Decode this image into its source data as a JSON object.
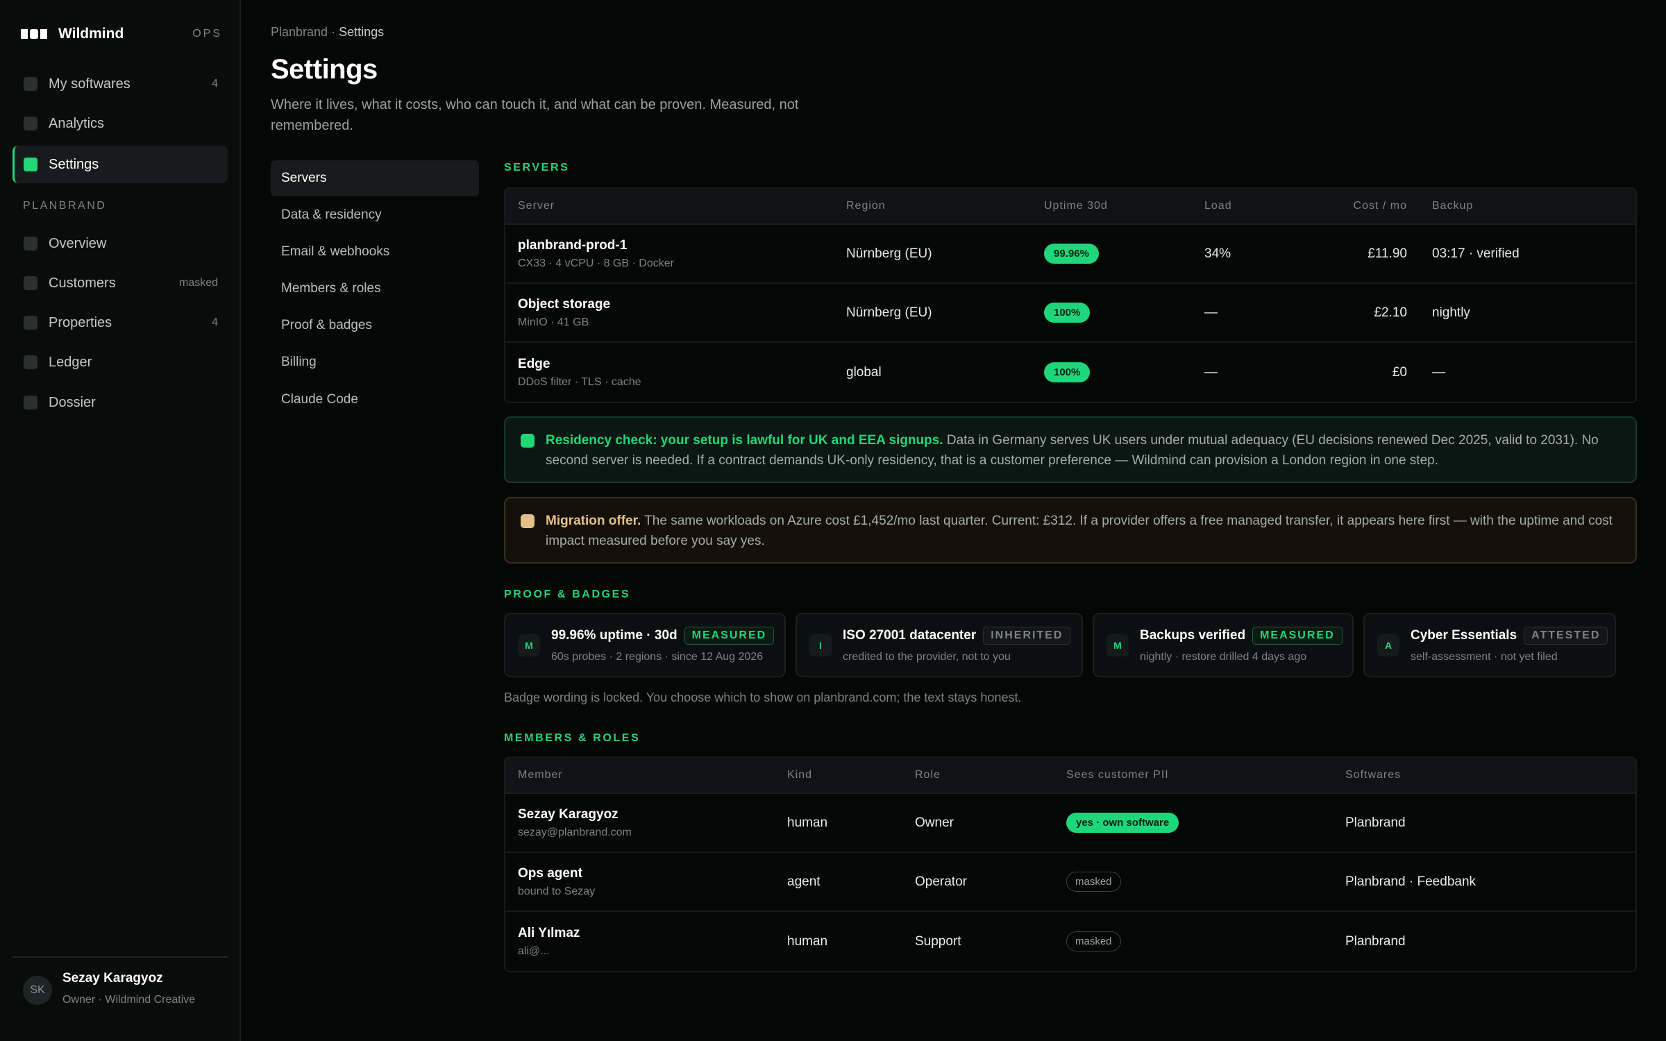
{
  "app": {
    "name": "Wildmind",
    "env": "OPS"
  },
  "sidebar": {
    "items": [
      {
        "label": "My softwares",
        "count": "4"
      },
      {
        "label": "Analytics",
        "count": ""
      },
      {
        "label": "Settings",
        "count": "",
        "active": true
      }
    ],
    "section_label": "PLANBRAND",
    "section_items": [
      {
        "label": "Overview",
        "count": ""
      },
      {
        "label": "Customers",
        "count": "masked"
      },
      {
        "label": "Properties",
        "count": "4"
      },
      {
        "label": "Ledger",
        "count": ""
      },
      {
        "label": "Dossier",
        "count": ""
      }
    ],
    "user": {
      "initials": "SK",
      "name": "Sezay Karagyoz",
      "role": "Owner · Wildmind Creative"
    }
  },
  "header": {
    "breadcrumb_parent": "Planbrand",
    "breadcrumb_sep": "·",
    "breadcrumb_current": "Settings",
    "title": "Settings",
    "subtitle": "Where it lives, what it costs, who can touch it, and what can be proven. Measured, not remembered."
  },
  "subnav": [
    "Servers",
    "Data & residency",
    "Email & webhooks",
    "Members & roles",
    "Proof & badges",
    "Billing",
    "Claude Code"
  ],
  "servers": {
    "title": "SERVERS",
    "columns": [
      "Server",
      "Region",
      "Uptime 30d",
      "Load",
      "Cost / mo",
      "Backup"
    ],
    "rows": [
      {
        "name": "planbrand-prod-1",
        "spec": "CX33 · 4 vCPU · 8 GB · Docker",
        "region": "Nürnberg (EU)",
        "uptime": "99.96%",
        "load": "34%",
        "cost": "£11.90",
        "backup": "03:17 · verified"
      },
      {
        "name": "Object storage",
        "spec": "MinIO · 41 GB",
        "region": "Nürnberg (EU)",
        "uptime": "100%",
        "load": "—",
        "cost": "£2.10",
        "backup": "nightly"
      },
      {
        "name": "Edge",
        "spec": "DDoS filter · TLS · cache",
        "region": "global",
        "uptime": "100%",
        "load": "—",
        "cost": "£0",
        "backup": "—"
      }
    ]
  },
  "residency": {
    "headline": "Residency check: your setup is lawful for UK and EEA signups.",
    "body": "Data in Germany serves UK users under mutual adequacy (EU decisions renewed Dec 2025, valid to 2031). No second server is needed. If a contract demands UK-only residency, that is a customer preference — Wildmind can provision a London region in one step."
  },
  "migration": {
    "headline": "Migration offer.",
    "body": "The same workloads on Azure cost £1,452/mo last quarter. Current: £312. If a provider offers a free managed transfer, it appears here first — with the uptime and cost impact measured before you say yes."
  },
  "proof": {
    "title": "PROOF & BADGES",
    "badges": [
      {
        "letter": "M",
        "title": "99.96% uptime · 30d",
        "tag": "MEASURED",
        "sub": "60s probes · 2 regions · since 12 Aug 2026"
      },
      {
        "letter": "I",
        "title": "ISO 27001 datacenter",
        "tag": "INHERITED",
        "sub": "credited to the provider, not to you"
      },
      {
        "letter": "M",
        "title": "Backups verified",
        "tag": "MEASURED",
        "sub": "nightly · restore drilled 4 days ago"
      },
      {
        "letter": "A",
        "title": "Cyber Essentials",
        "tag": "ATTESTED",
        "sub": "self-assessment · not yet filed"
      }
    ],
    "note": "Badge wording is locked. You choose which to show on planbrand.com; the text stays honest."
  },
  "members": {
    "title": "MEMBERS & ROLES",
    "columns": [
      "Member",
      "Kind",
      "Role",
      "Sees customer PII",
      "Softwares"
    ],
    "rows": [
      {
        "name": "Sezay Karagyoz",
        "detail": "sezay@planbrand.com",
        "kind": "human",
        "role": "Owner",
        "pii": "yes · own software",
        "softwares": "Planbrand"
      },
      {
        "name": "Ops agent",
        "detail": "bound to Sezay",
        "kind": "agent",
        "role": "Operator",
        "pii": "masked",
        "softwares": "Planbrand · Feedbank"
      },
      {
        "name": "Ali Yılmaz",
        "detail": "ali@...",
        "kind": "human",
        "role": "Support",
        "pii": "masked",
        "softwares": "Planbrand"
      }
    ]
  },
  "colors": {
    "accent": "#22d67a",
    "amber": "#e6c084",
    "background": "#050606"
  }
}
